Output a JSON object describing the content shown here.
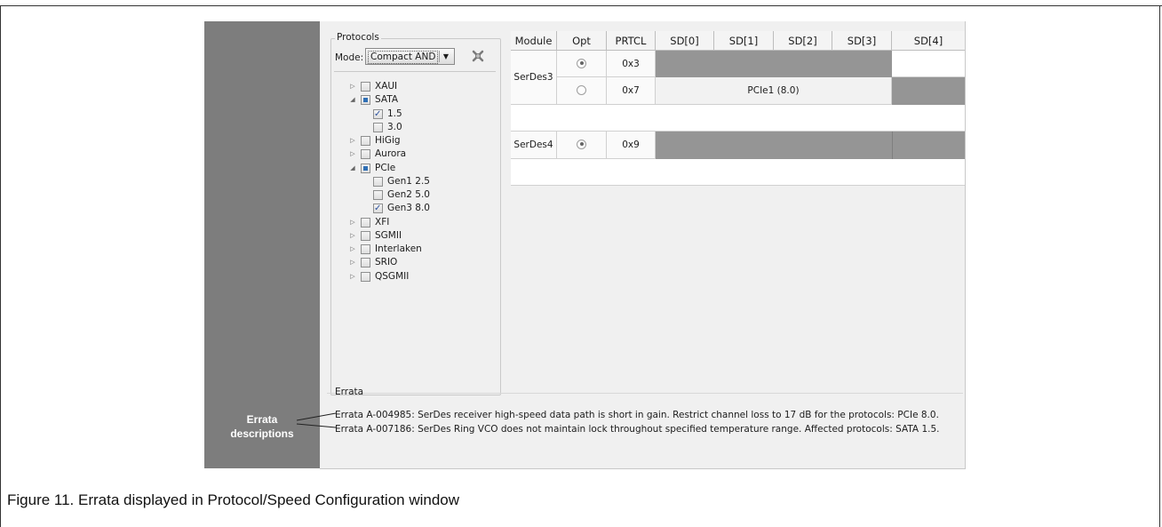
{
  "protocols": {
    "title": "Protocols",
    "mode_label": "Mode:",
    "mode_value": "Compact AND",
    "tree": [
      {
        "label": "XAUI",
        "level": 0,
        "twisty": "collapsed",
        "state": "unchecked"
      },
      {
        "label": "SATA",
        "level": 0,
        "twisty": "expanded",
        "state": "partial"
      },
      {
        "label": "1.5",
        "level": 1,
        "twisty": "none",
        "state": "checked"
      },
      {
        "label": "3.0",
        "level": 1,
        "twisty": "none",
        "state": "unchecked"
      },
      {
        "label": "HiGig",
        "level": 0,
        "twisty": "collapsed",
        "state": "unchecked"
      },
      {
        "label": "Aurora",
        "level": 0,
        "twisty": "collapsed",
        "state": "unchecked"
      },
      {
        "label": "PCIe",
        "level": 0,
        "twisty": "expanded",
        "state": "partial"
      },
      {
        "label": "Gen1 2.5",
        "level": 1,
        "twisty": "none",
        "state": "unchecked"
      },
      {
        "label": "Gen2 5.0",
        "level": 1,
        "twisty": "none",
        "state": "unchecked"
      },
      {
        "label": "Gen3 8.0",
        "level": 1,
        "twisty": "none",
        "state": "checked"
      },
      {
        "label": "XFI",
        "level": 0,
        "twisty": "collapsed",
        "state": "unchecked"
      },
      {
        "label": "SGMII",
        "level": 0,
        "twisty": "collapsed",
        "state": "unchecked"
      },
      {
        "label": "Interlaken",
        "level": 0,
        "twisty": "collapsed",
        "state": "unchecked"
      },
      {
        "label": "SRIO",
        "level": 0,
        "twisty": "collapsed",
        "state": "unchecked"
      },
      {
        "label": "QSGMII",
        "level": 0,
        "twisty": "collapsed",
        "state": "unchecked"
      }
    ]
  },
  "table": {
    "headers": [
      "Module",
      "Opt",
      "PRTCL",
      "SD[0]",
      "SD[1]",
      "SD[2]",
      "SD[3]",
      "SD[4]"
    ],
    "serdes3": {
      "module": "SerDes3",
      "rows": [
        {
          "opt": "selected",
          "prtcl": "0x3"
        },
        {
          "opt": "unselected",
          "prtcl": "0x7",
          "span_label": "PCIe1 (8.0)"
        }
      ]
    },
    "serdes4": {
      "module": "SerDes4",
      "rows": [
        {
          "opt": "selected",
          "prtcl": "0x9"
        }
      ]
    }
  },
  "errata": {
    "title": "Errata",
    "lines": [
      "Errata A-004985: SerDes receiver high-speed data path is short in gain. Restrict channel loss to 17 dB for the protocols: PCIe 8.0.",
      "Errata A-007186: SerDes Ring VCO does not maintain lock throughout specified temperature range. Affected protocols: SATA 1.5."
    ]
  },
  "callout": {
    "line1": "Errata",
    "line2": "descriptions"
  },
  "caption": "Figure 11. Errata displayed in Protocol/Speed Configuration window",
  "colors": {
    "sidebar_gray": "#7d7d7d",
    "shaded_lane": "#959595",
    "window_bg": "#f0f0f0"
  }
}
